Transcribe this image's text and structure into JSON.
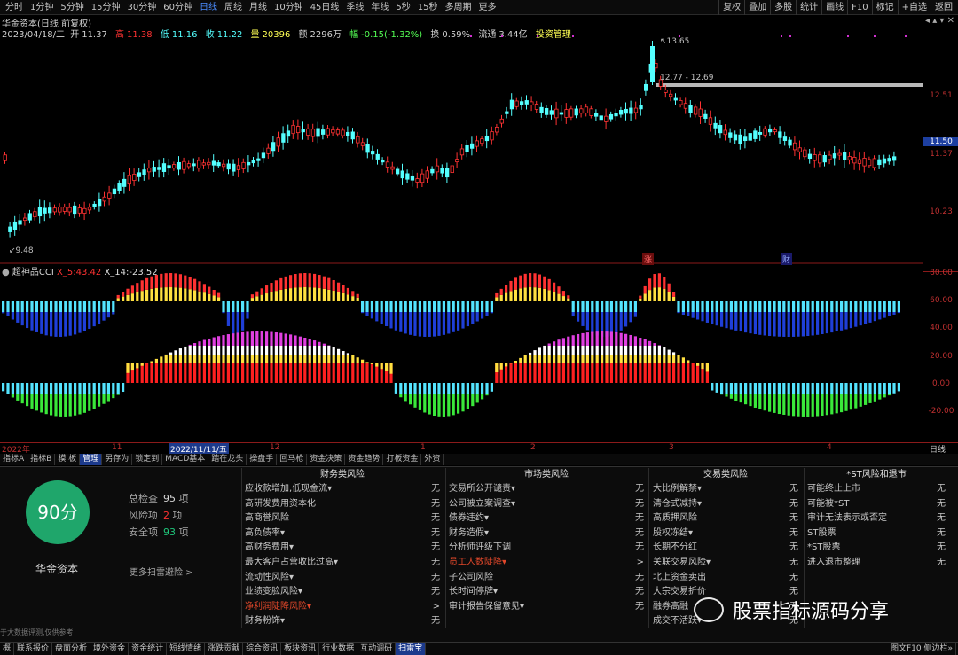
{
  "topbar": {
    "periods": [
      "分时",
      "1分钟",
      "5分钟",
      "15分钟",
      "30分钟",
      "60分钟",
      "日线",
      "周线",
      "月线",
      "10分钟",
      "45日线",
      "季线",
      "年线",
      "5秒",
      "15秒",
      "多周期",
      "更多"
    ],
    "selected": "日线",
    "tools": [
      "复权",
      "叠加",
      "多股",
      "统计",
      "画线",
      "F10",
      "标记",
      "+自选",
      "返回"
    ]
  },
  "header": {
    "title": "华金资本(日线 前复权)",
    "date": "2023/04/18/二",
    "open_label": "开",
    "open": "11.37",
    "high_label": "高",
    "high": "11.38",
    "low_label": "低",
    "low": "11.16",
    "close_label": "收",
    "close": "11.22",
    "vol_label": "量",
    "vol": "20396",
    "amt_label": "额",
    "amt": "2296万",
    "chg_label": "幅",
    "chg": "-0.15(-1.32%)",
    "turn_label": "换",
    "turn": "0.59%",
    "float_label": "流通",
    "float": "3.44亿",
    "mgmt": "投资管理"
  },
  "price_axis": {
    "labels": [
      "12.51",
      "11.50",
      "11.37",
      "10.23"
    ],
    "current": "11.50"
  },
  "annotations": {
    "high": "13.65",
    "range": "12.77 - 12.69",
    "low": "9.48",
    "tag_zhang": "涨",
    "tag_cai": "财"
  },
  "indicator": {
    "name": "超神品CCI",
    "x5_label": "X_5:",
    "x5": "43.42",
    "x14_label": "X_14:",
    "x14": "-23.52",
    "axis": [
      "80.00",
      "60.00",
      "40.00",
      "20.00",
      "0.00",
      "-20.00"
    ]
  },
  "datebar": {
    "year": "2022年",
    "m11": "11",
    "cursor": "2022/11/11/五",
    "m12": "12",
    "m1": "1",
    "m2": "2",
    "m3": "3",
    "m4": "4",
    "period": "日线"
  },
  "tabs": [
    "指标A",
    "指标B",
    "模 板",
    "管理",
    "另存为",
    "锁定到",
    "MACD基本",
    "踏在龙头",
    "操盘手",
    "回马枪",
    "资金决策",
    "资金趋势",
    "打板资金",
    "外资"
  ],
  "tabs_selected": "管理",
  "panel": {
    "score": "90分",
    "company": "华金资本",
    "checks_label": "总检查",
    "checks": "95",
    "unit": "项",
    "risk_label": "风险项",
    "risk": "2",
    "safe_label": "安全项",
    "safe": "93",
    "more": "更多扫雷避险 >",
    "disclaimer": "于大数据评测,仅供参考",
    "columns": [
      {
        "title": "财务类风险",
        "items": [
          {
            "label": "应收款增加,低现金流▾",
            "value": "无"
          },
          {
            "label": "高研发费用资本化",
            "value": "无"
          },
          {
            "label": "高商誉风险",
            "value": "无"
          },
          {
            "label": "高负债率▾",
            "value": "无"
          },
          {
            "label": "高财务费用▾",
            "value": "无"
          },
          {
            "label": "最大客户占营收比过高▾",
            "value": "无"
          },
          {
            "label": "流动性风险▾",
            "value": "无"
          },
          {
            "label": "业绩变脸风险▾",
            "value": "无"
          },
          {
            "label": "净利润陡降风险▾",
            "value": ">",
            "hl": true
          },
          {
            "label": "财务粉饰▾",
            "value": "无"
          }
        ]
      },
      {
        "title": "市场类风险",
        "items": [
          {
            "label": "交易所公开谴责▾",
            "value": "无"
          },
          {
            "label": "公司被立案调查▾",
            "value": "无"
          },
          {
            "label": "债券违约▾",
            "value": "无"
          },
          {
            "label": "财务造假▾",
            "value": "无"
          },
          {
            "label": "分析师评级下调",
            "value": "无"
          },
          {
            "label": "员工人数陡降▾",
            "value": ">",
            "hl": true
          },
          {
            "label": "子公司风险",
            "value": "无"
          },
          {
            "label": "长时间停牌▾",
            "value": "无"
          },
          {
            "label": "审计报告保留意见▾",
            "value": "无"
          }
        ]
      },
      {
        "title": "交易类风险",
        "items": [
          {
            "label": "大比例解禁▾",
            "value": "无"
          },
          {
            "label": "清仓式减持▾",
            "value": "无"
          },
          {
            "label": "高质押风险",
            "value": "无"
          },
          {
            "label": "股权冻结▾",
            "value": "无"
          },
          {
            "label": "长期不分红",
            "value": "无"
          },
          {
            "label": "关联交易风险▾",
            "value": "无"
          },
          {
            "label": "北上资金卖出",
            "value": "无"
          },
          {
            "label": "大宗交易折价",
            "value": "无"
          },
          {
            "label": "融券高融",
            "value": "无"
          },
          {
            "label": "成交不活跃▾",
            "value": "无"
          }
        ]
      },
      {
        "title": "*ST风险和退市",
        "items": [
          {
            "label": "可能终止上市",
            "value": "无"
          },
          {
            "label": "可能被*ST",
            "value": "无"
          },
          {
            "label": "审计无法表示或否定",
            "value": "无"
          },
          {
            "label": "ST股票",
            "value": "无"
          },
          {
            "label": "*ST股票",
            "value": "无"
          },
          {
            "label": "进入退市整理",
            "value": "无"
          }
        ]
      }
    ]
  },
  "bottombar": {
    "items": [
      "概",
      "联系报价",
      "盘面分析",
      "境外资金",
      "资金统计",
      "短线情绪",
      "涨跌贡献",
      "综合资讯",
      "板块资讯",
      "行业数据",
      "互动调研",
      "扫雷宝"
    ],
    "selected": "扫雷宝",
    "right": "图文F10 侧边栏»"
  },
  "watermark": "股票指标源码分享",
  "colors": {
    "up": "#ff3232",
    "down": "#54ffff",
    "axis": "#8b1a1a"
  }
}
